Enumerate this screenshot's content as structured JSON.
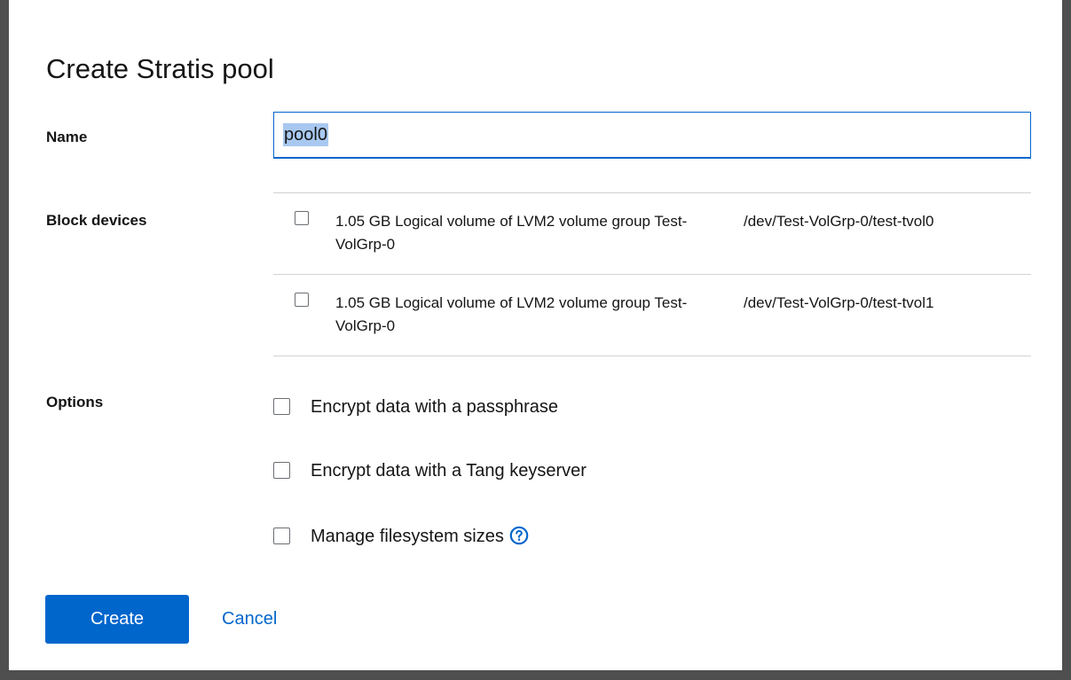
{
  "dialog": {
    "title": "Create Stratis pool"
  },
  "name_field": {
    "label": "Name",
    "value": "pool0"
  },
  "block_devices": {
    "label": "Block devices",
    "items": [
      {
        "description": "1.05 GB Logical volume of LVM2 volume group Test-VolGrp-0",
        "path": "/dev/Test-VolGrp-0/test-tvol0",
        "checked": false
      },
      {
        "description": "1.05 GB Logical volume of LVM2 volume group Test-VolGrp-0",
        "path": "/dev/Test-VolGrp-0/test-tvol1",
        "checked": false
      }
    ]
  },
  "options": {
    "label": "Options",
    "items": [
      {
        "label": "Encrypt data with a passphrase",
        "checked": false
      },
      {
        "label": "Encrypt data with a Tang keyserver",
        "checked": false
      },
      {
        "label": "Manage filesystem sizes",
        "checked": false,
        "help_icon": "help-circle-icon"
      }
    ]
  },
  "actions": {
    "create_label": "Create",
    "cancel_label": "Cancel"
  },
  "colors": {
    "primary": "#0066cc",
    "text": "#151515",
    "border": "#d2d2d2",
    "backdrop": "#4f4f4f"
  }
}
